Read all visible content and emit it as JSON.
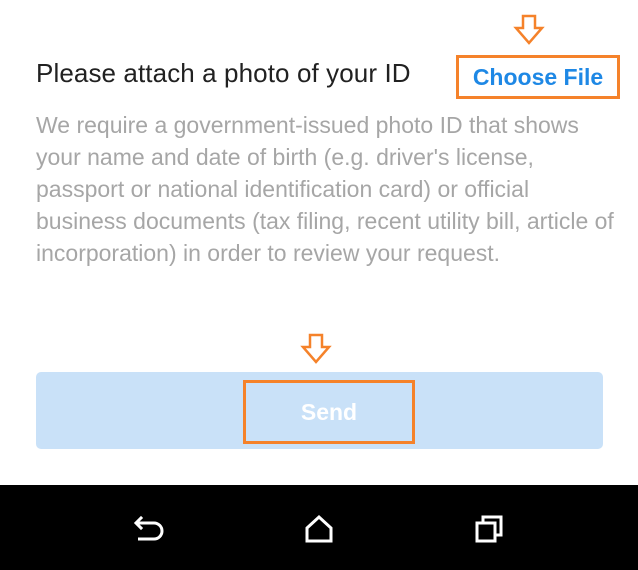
{
  "form": {
    "title": "Please attach a photo of your ID",
    "choose_file_label": "Choose File",
    "description": "We require a government-issued photo ID that shows your name and date of birth (e.g. driver's license, passport or national identification card) or official business documents (tax filing, recent utility bill, article of incorporation) in order to review your request.",
    "send_label": "Send"
  },
  "annotations": {
    "highlight_color": "#f5822a",
    "arrow_icon": "arrow-down-icon"
  },
  "navbar": {
    "items": [
      {
        "icon": "back-icon"
      },
      {
        "icon": "home-icon"
      },
      {
        "icon": "recents-icon"
      }
    ]
  },
  "colors": {
    "link": "#1e88e5",
    "send_background": "#c9e1f8",
    "description_text": "#a6a6a6",
    "title_text": "#212121",
    "navbar_background": "#000000"
  }
}
